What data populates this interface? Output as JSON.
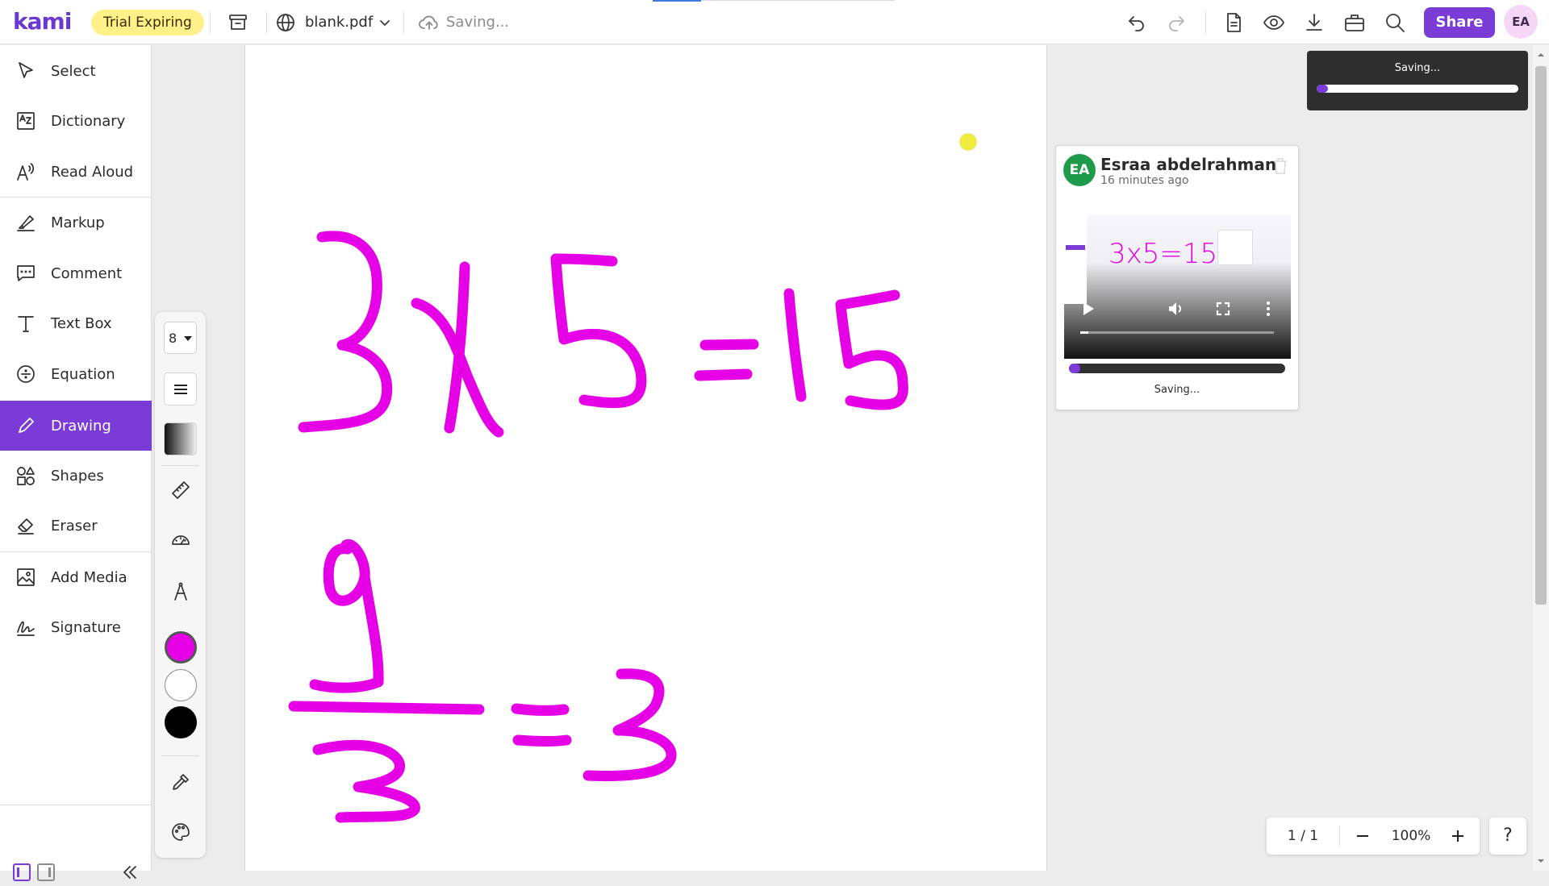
{
  "app": {
    "logo": "kami",
    "trial_badge": "Trial Expiring"
  },
  "document": {
    "name": "blank.pdf",
    "save_status": "Saving..."
  },
  "header": {
    "share_label": "Share",
    "user_initials": "EA"
  },
  "sidebar": {
    "items": [
      {
        "id": "select",
        "label": "Select",
        "icon": "cursor-icon"
      },
      {
        "id": "dictionary",
        "label": "Dictionary",
        "icon": "dictionary-icon"
      },
      {
        "id": "read-aloud",
        "label": "Read Aloud",
        "icon": "read-aloud-icon"
      },
      {
        "id": "markup",
        "label": "Markup",
        "icon": "highlighter-icon"
      },
      {
        "id": "comment",
        "label": "Comment",
        "icon": "comment-icon"
      },
      {
        "id": "text-box",
        "label": "Text Box",
        "icon": "text-icon"
      },
      {
        "id": "equation",
        "label": "Equation",
        "icon": "equation-icon"
      },
      {
        "id": "drawing",
        "label": "Drawing",
        "icon": "pen-icon",
        "active": true
      },
      {
        "id": "shapes",
        "label": "Shapes",
        "icon": "shapes-icon"
      },
      {
        "id": "eraser",
        "label": "Eraser",
        "icon": "eraser-icon"
      },
      {
        "id": "add-media",
        "label": "Add Media",
        "icon": "media-icon"
      },
      {
        "id": "signature",
        "label": "Signature",
        "icon": "signature-icon"
      }
    ]
  },
  "drawing_toolbar": {
    "stroke_size": "8",
    "colors": {
      "active": "#e600e6",
      "white": "#ffffff",
      "black": "#000000"
    }
  },
  "canvas": {
    "ink_color": "#e600e6",
    "handwriting": "3x5=15 and 9/3=3"
  },
  "toast": {
    "text": "Saving...",
    "progress": 0.02
  },
  "comment": {
    "initials": "EA",
    "author": "Esraa abdelrahman",
    "time": "16 minutes ago",
    "video_preview_text": "3x5=15",
    "upload_progress": 0.03,
    "status": "Saving..."
  },
  "page_nav": {
    "page": "1 / 1",
    "zoom": "100%"
  },
  "colors": {
    "accent": "#7a3bd6",
    "trial_badge": "#fff08a",
    "comment_avatar": "#1f9a4a"
  }
}
